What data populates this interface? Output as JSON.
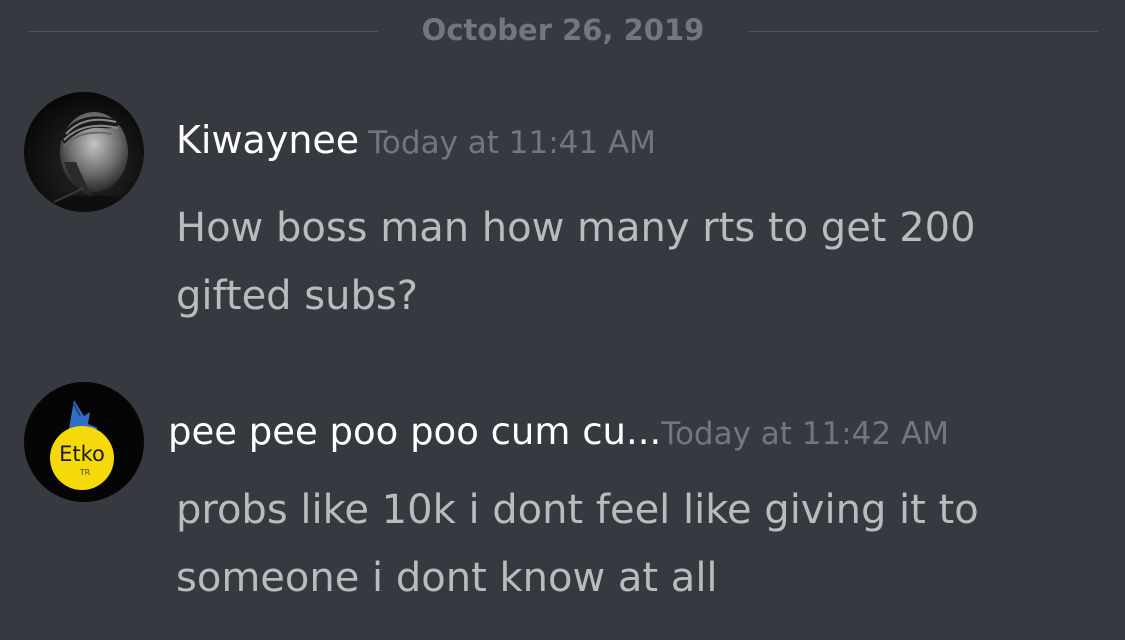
{
  "divider": {
    "date": "October 26, 2019"
  },
  "messages": [
    {
      "username": "Kiwaynee",
      "timestamp": "Today at 11:41 AM",
      "text": "How boss man how many rts to get 200 gifted subs?",
      "avatar": "profile-photo-avatar"
    },
    {
      "username": "pee pee poo poo cum cu...",
      "timestamp": "Today at 11:42 AM",
      "text": "probs like 10k i dont feel like giving it to someone i dont know at all",
      "avatar": "etko-wolf-logo-avatar",
      "avatar_text": "Etko",
      "avatar_subtext": "TR"
    }
  ],
  "colors": {
    "background": "#36393f",
    "username": "#ffffff",
    "timestamp": "#72767d",
    "message_text": "#b9bbbe",
    "divider_line": "#4f545c",
    "etko_yellow": "#f5d90a",
    "etko_blue": "#2f6ec4"
  }
}
